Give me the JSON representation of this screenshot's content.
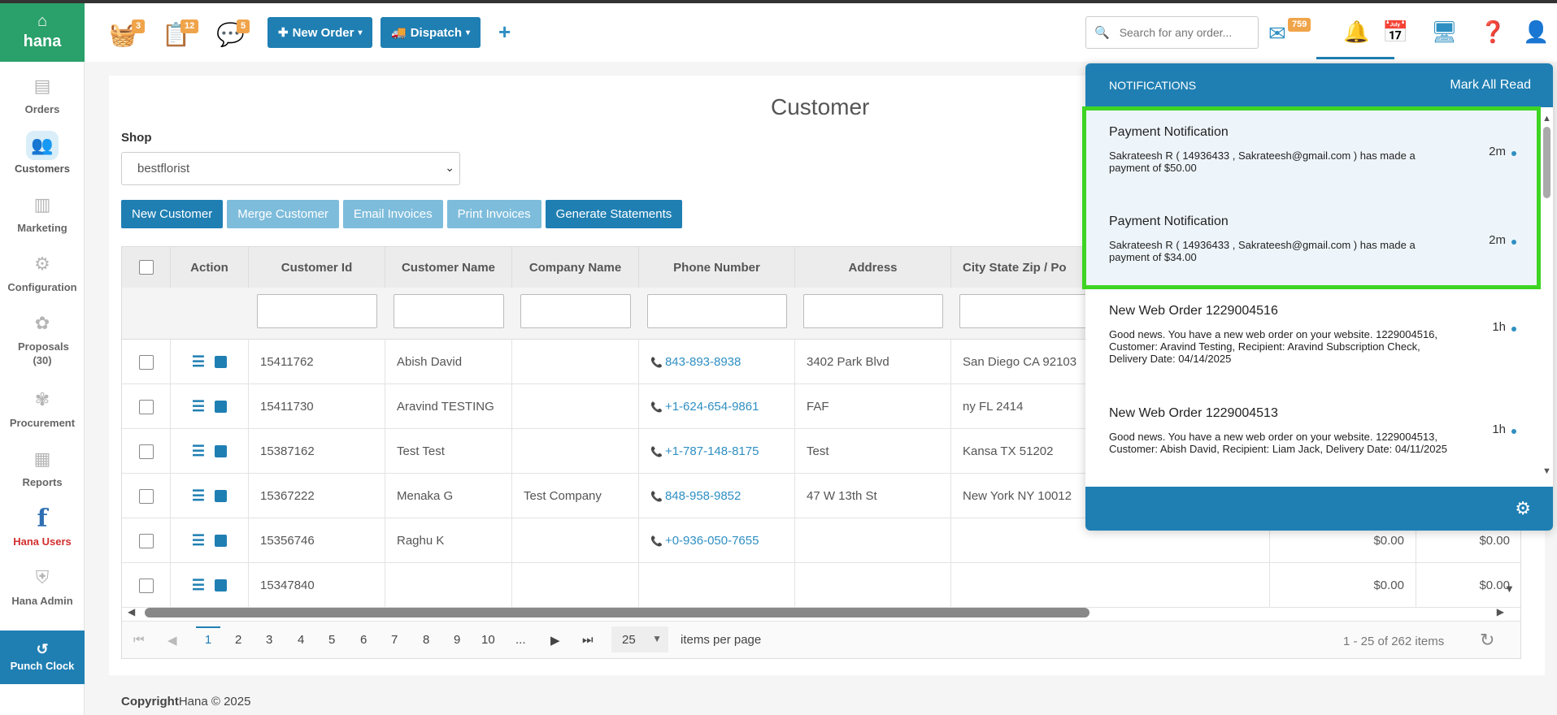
{
  "app": {
    "brand": "hana"
  },
  "sidebar": {
    "items": [
      {
        "label": "Orders",
        "icon": "orders-icon",
        "glyph": "▤"
      },
      {
        "label": "Customers",
        "icon": "customers-icon",
        "glyph": "👥"
      },
      {
        "label": "Marketing",
        "icon": "marketing-icon",
        "glyph": "▥"
      },
      {
        "label": "Configuration",
        "icon": "configuration-icon",
        "glyph": "⚙"
      },
      {
        "label": "Proposals (30)",
        "icon": "proposals-icon",
        "glyph": "✿"
      },
      {
        "label": "Procurement",
        "icon": "procurement-icon",
        "glyph": "✾"
      },
      {
        "label": "Reports",
        "icon": "reports-icon",
        "glyph": "▦"
      },
      {
        "label": "Hana Users",
        "icon": "facebook-icon",
        "glyph": "f"
      },
      {
        "label": "Hana Admin",
        "icon": "admin-shield-icon",
        "glyph": "⛨"
      }
    ],
    "punch_clock": "Punch Clock"
  },
  "topbar": {
    "basket_badge": "3",
    "clipboard_badge": "12",
    "chat_badge": "5",
    "new_order": "New Order",
    "dispatch": "Dispatch",
    "search_placeholder": "Search for any order...",
    "mail_badge": "759"
  },
  "page": {
    "title": "Customer",
    "shop_label": "Shop",
    "shop_value": "bestflorist",
    "buttons": {
      "new_customer": "New Customer",
      "merge_customer": "Merge Customer",
      "email_invoices": "Email Invoices",
      "print_invoices": "Print Invoices",
      "generate_statements": "Generate Statements"
    }
  },
  "table": {
    "columns": [
      "Action",
      "Customer Id",
      "Customer Name",
      "Company Name",
      "Phone Number",
      "Address",
      "City State Zip / Po"
    ],
    "rows": [
      {
        "id": "15411762",
        "name": "Abish David",
        "company": "",
        "phone": "843-893-8938",
        "address": "3402 Park Blvd",
        "city": "San Diego CA 92103",
        "bal1": "",
        "bal2": ""
      },
      {
        "id": "15411730",
        "name": "Aravind TESTING",
        "company": "",
        "phone": "+1-624-654-9861",
        "address": "FAF",
        "city": "ny FL 2414",
        "bal1": "",
        "bal2": ""
      },
      {
        "id": "15387162",
        "name": "Test Test",
        "company": "",
        "phone": "+1-787-148-8175",
        "address": "Test",
        "city": "Kansa TX 51202",
        "bal1": "",
        "bal2": ""
      },
      {
        "id": "15367222",
        "name": "Menaka G",
        "company": "Test Company",
        "phone": "848-958-9852",
        "address": "47 W 13th St",
        "city": "New York NY 10012",
        "bal1": "",
        "bal2": ""
      },
      {
        "id": "15356746",
        "name": "Raghu K",
        "company": "",
        "phone": "+0-936-050-7655",
        "address": "",
        "city": "",
        "bal1": "$0.00",
        "bal2": "$0.00"
      },
      {
        "id": "15347840",
        "name": "",
        "company": "",
        "phone": "",
        "address": "",
        "city": "",
        "bal1": "$0.00",
        "bal2": "$0.00"
      }
    ]
  },
  "pager": {
    "pages": [
      "1",
      "2",
      "3",
      "4",
      "5",
      "6",
      "7",
      "8",
      "9",
      "10",
      "..."
    ],
    "per_page": "25",
    "per_page_label": "items per page",
    "info": "1 - 25 of 262 items"
  },
  "footer": {
    "copyright_bold": "Copyright",
    "copyright_rest": "Hana © 2025"
  },
  "notifications": {
    "title": "NOTIFICATIONS",
    "mark_all": "Mark All Read",
    "items": [
      {
        "title": "Payment Notification",
        "text": "Sakrateesh R ( 14936433 , Sakrateesh@gmail.com ) has made a payment of $50.00",
        "time": "2m"
      },
      {
        "title": "Payment Notification",
        "text": "Sakrateesh R ( 14936433 , Sakrateesh@gmail.com ) has made a payment of $34.00",
        "time": "2m"
      },
      {
        "title": "New Web Order 1229004516",
        "text": "Good news. You have a new web order on your website. 1229004516, Customer: Aravind Testing, Recipient: Aravind Subscription Check, Delivery Date: 04/14/2025",
        "time": "1h"
      },
      {
        "title": "New Web Order 1229004513",
        "text": "Good news. You have a new web order on your website. 1229004513, Customer: Abish David, Recipient: Liam Jack, Delivery Date: 04/11/2025",
        "time": "1h"
      }
    ]
  },
  "colors": {
    "brand_green": "#2aa06a",
    "primary_blue": "#1f7fb3",
    "badge_orange": "#f0a44a",
    "highlight_green": "#3ed423"
  }
}
